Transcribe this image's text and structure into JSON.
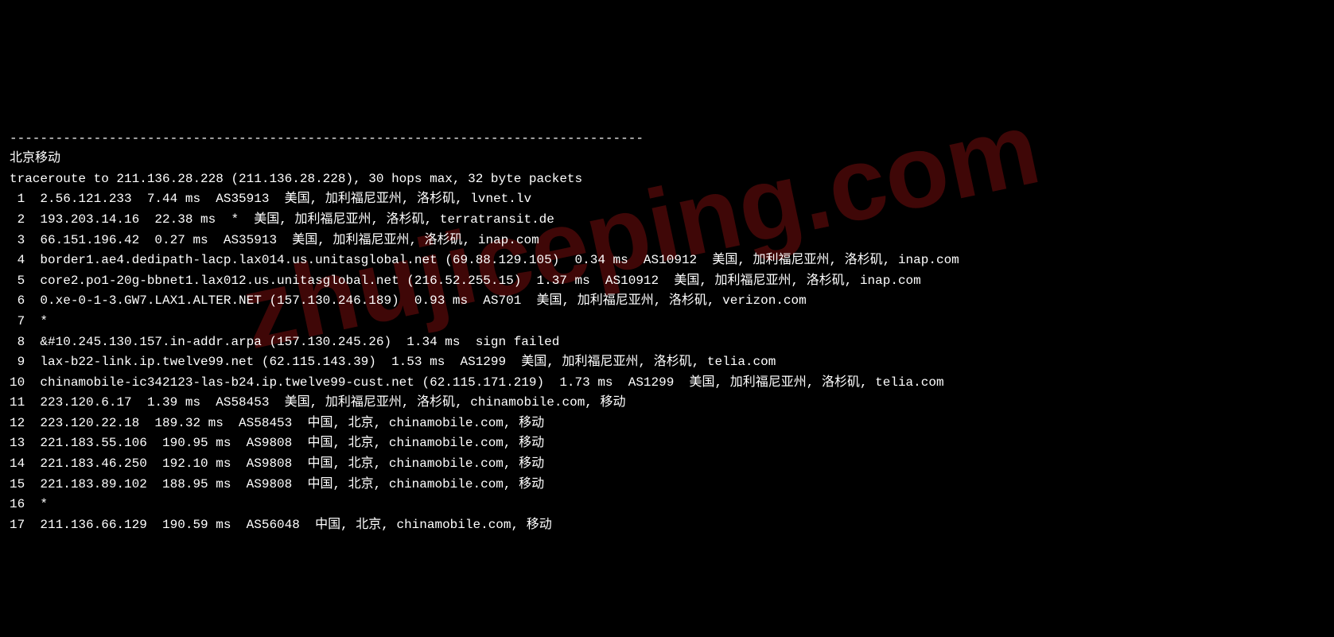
{
  "watermark": "zhujiceping.com",
  "separator": "-----------------------------------------------------------------------------------",
  "title": "北京移动",
  "header": "traceroute to 211.136.28.228 (211.136.28.228), 30 hops max, 32 byte packets",
  "hops": [
    " 1  2.56.121.233  7.44 ms  AS35913  美国, 加利福尼亚州, 洛杉矶, lvnet.lv",
    " 2  193.203.14.16  22.38 ms  *  美国, 加利福尼亚州, 洛杉矶, terratransit.de",
    " 3  66.151.196.42  0.27 ms  AS35913  美国, 加利福尼亚州, 洛杉矶, inap.com",
    " 4  border1.ae4.dedipath-lacp.lax014.us.unitasglobal.net (69.88.129.105)  0.34 ms  AS10912  美国, 加利福尼亚州, 洛杉矶, inap.com",
    " 5  core2.po1-20g-bbnet1.lax012.us.unitasglobal.net (216.52.255.15)  1.37 ms  AS10912  美国, 加利福尼亚州, 洛杉矶, inap.com",
    " 6  0.xe-0-1-3.GW7.LAX1.ALTER.NET (157.130.246.189)  0.93 ms  AS701  美国, 加利福尼亚州, 洛杉矶, verizon.com",
    " 7  *",
    " 8  &#10.245.130.157.in-addr.arpa (157.130.245.26)  1.34 ms  sign failed",
    " 9  lax-b22-link.ip.twelve99.net (62.115.143.39)  1.53 ms  AS1299  美国, 加利福尼亚州, 洛杉矶, telia.com",
    "10  chinamobile-ic342123-las-b24.ip.twelve99-cust.net (62.115.171.219)  1.73 ms  AS1299  美国, 加利福尼亚州, 洛杉矶, telia.com",
    "11  223.120.6.17  1.39 ms  AS58453  美国, 加利福尼亚州, 洛杉矶, chinamobile.com, 移动",
    "12  223.120.22.18  189.32 ms  AS58453  中国, 北京, chinamobile.com, 移动",
    "13  221.183.55.106  190.95 ms  AS9808  中国, 北京, chinamobile.com, 移动",
    "14  221.183.46.250  192.10 ms  AS9808  中国, 北京, chinamobile.com, 移动",
    "15  221.183.89.102  188.95 ms  AS9808  中国, 北京, chinamobile.com, 移动",
    "16  *",
    "17  211.136.66.129  190.59 ms  AS56048  中国, 北京, chinamobile.com, 移动"
  ]
}
